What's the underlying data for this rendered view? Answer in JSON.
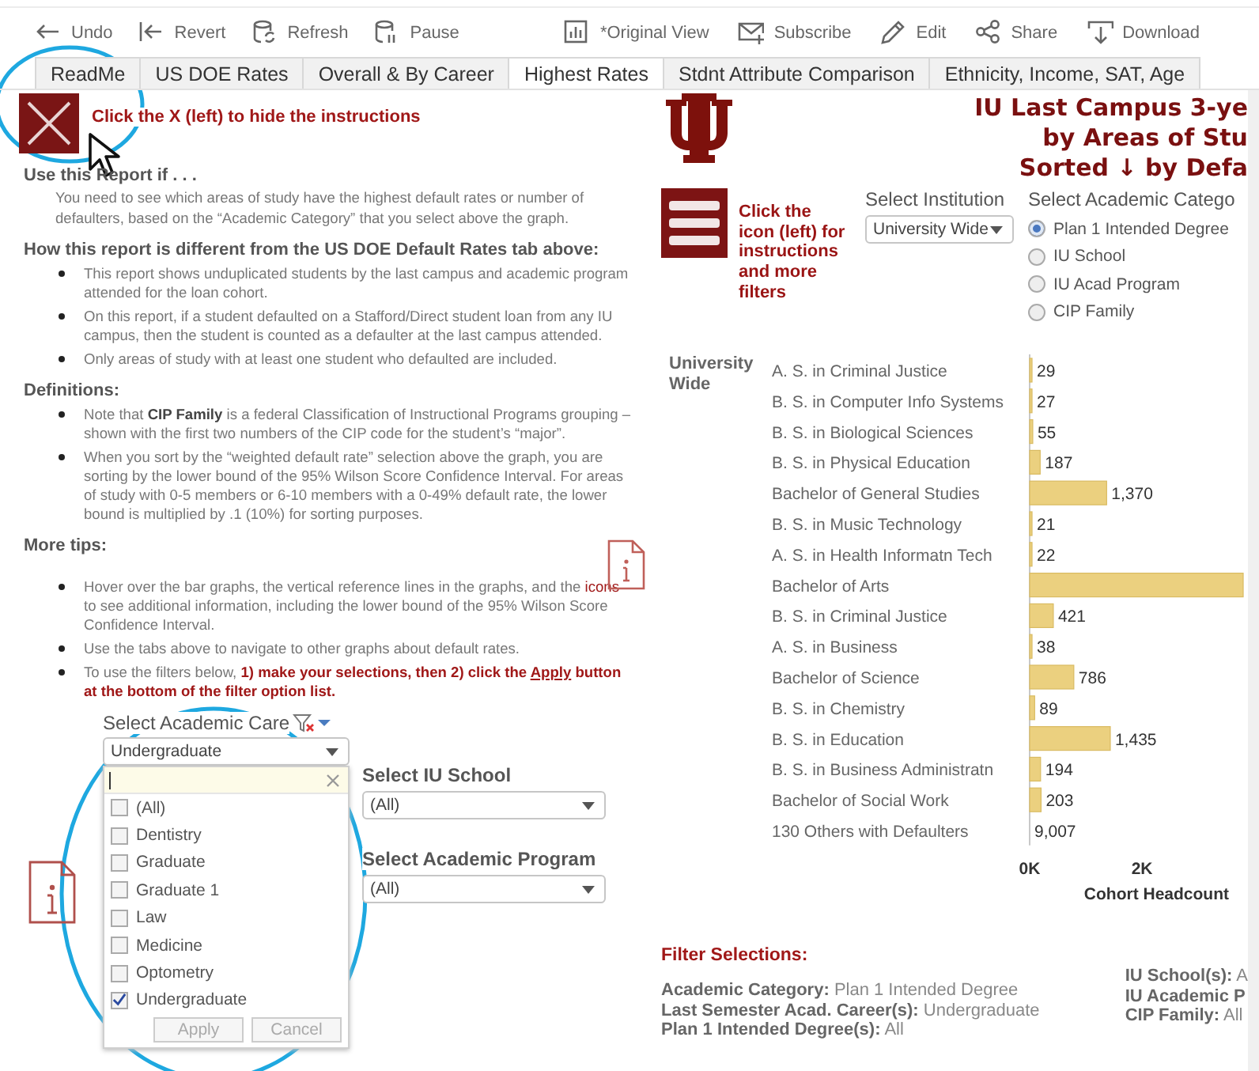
{
  "toolbar": {
    "left": [
      {
        "label": "Undo"
      },
      {
        "label": "Revert"
      },
      {
        "label": "Refresh"
      },
      {
        "label": "Pause"
      }
    ],
    "right": [
      {
        "label": "*Original View"
      },
      {
        "label": "Subscribe"
      },
      {
        "label": "Edit"
      },
      {
        "label": "Share"
      },
      {
        "label": "Download"
      }
    ]
  },
  "tabs": [
    {
      "label": "ReadMe",
      "selected": false
    },
    {
      "label": "US DOE Rates",
      "selected": false
    },
    {
      "label": "Overall & By Career",
      "selected": false
    },
    {
      "label": "Highest Rates",
      "selected": true
    },
    {
      "label": "Stdnt Attribute Comparison",
      "selected": false
    },
    {
      "label": "Ethnicity, Income, SAT, Age",
      "selected": false
    }
  ],
  "instructions": {
    "hide_text": "Click the X (left) to hide the instructions",
    "sections": [
      {
        "heading": "Use this Report if . . .",
        "kind": "paragraph",
        "items": [
          [
            {
              "text": "You need to see which areas of study have the highest default rates or number of defaulters, based on the “Academic Category” that you select above the graph.",
              "kind": "text"
            }
          ]
        ]
      },
      {
        "heading": "How this report is different from the US DOE Default Rates tab above:",
        "kind": "bullets",
        "items": [
          [
            {
              "text": "This report shows unduplicated students by the last campus and academic program attended for the loan cohort.",
              "kind": "text"
            }
          ],
          [
            {
              "text": "On this report, if a student defaulted on a Stafford/Direct student loan from any IU campus, then the student is counted as a defaulter at the last campus attended.",
              "kind": "text"
            }
          ],
          [
            {
              "text": "Only areas of study with at least one student who defaulted are included.",
              "kind": "text"
            }
          ]
        ]
      },
      {
        "heading": "Definitions:",
        "kind": "bullets",
        "items": [
          [
            {
              "text": "Note that ",
              "kind": "text"
            },
            {
              "text": "CIP Family",
              "kind": "term"
            },
            {
              "text": " is a federal Classification of Instructional Programs grouping – shown with the first two numbers of the CIP code for the student’s “major”.",
              "kind": "text"
            }
          ],
          [
            {
              "text": "When you sort by the “weighted default rate” selection above the graph, you are sorting by the lower bound of the 95% Wilson Score Confidence Interval.  For areas of study with 0-5 members or 6-10 members with a 0-49% default rate, the lower bound is multiplied by .1 (10%) for sorting purposes.",
              "kind": "text"
            }
          ]
        ]
      },
      {
        "heading": "More tips:",
        "kind": "tips",
        "items": [
          [
            {
              "text": "Hover over the bar graphs, the vertical reference lines in the graphs, and the ",
              "kind": "text"
            },
            {
              "text": "icons",
              "kind": "highlight"
            },
            {
              "text": " to see additional information, including the lower bound of the 95% Wilson Score Confidence Interval.",
              "kind": "text"
            }
          ],
          [
            {
              "text": "Use the tabs above to navigate to other graphs about default rates.",
              "kind": "text"
            }
          ],
          [
            {
              "text": "To use the filters below, ",
              "kind": "text"
            },
            {
              "text": "1) make your selections, then 2) click the ",
              "kind": "instruction"
            },
            {
              "text": "Apply",
              "kind": "link"
            },
            {
              "text": " button at the bottom of the filter option list.",
              "kind": "instruction"
            }
          ]
        ]
      }
    ]
  },
  "career_filter": {
    "label": "Select Academic Care",
    "value": "Undergraduate",
    "options": [
      {
        "label": "(All)",
        "checked": false
      },
      {
        "label": "Dentistry",
        "checked": false
      },
      {
        "label": "Graduate",
        "checked": false
      },
      {
        "label": "Graduate 1",
        "checked": false
      },
      {
        "label": "Law",
        "checked": false
      },
      {
        "label": "Medicine",
        "checked": false
      },
      {
        "label": "Optometry",
        "checked": false
      },
      {
        "label": "Undergraduate",
        "checked": true
      }
    ],
    "buttons": [
      {
        "label": "Apply",
        "disabled": true
      },
      {
        "label": "Cancel",
        "disabled": true
      }
    ]
  },
  "school_filter": {
    "label": "Select IU School",
    "value": "(All)"
  },
  "program_filter": {
    "label": "Select Academic Program",
    "value": "(All)"
  },
  "title_lines": [
    "IU Last Campus 3-ye",
    "by Areas of Stu",
    "Sorted ↓ by Defa"
  ],
  "menu_hint": "Click the icon (left) for instructions and more filters",
  "institution": {
    "label": "Select Institution",
    "value": "University Wide"
  },
  "category": {
    "label": "Select Academic Catego",
    "options": [
      {
        "label": "Plan 1 Intended Degree",
        "selected": true
      },
      {
        "label": "IU School",
        "selected": false
      },
      {
        "label": "IU Acad Program",
        "selected": false
      },
      {
        "label": "CIP Family",
        "selected": false
      }
    ]
  },
  "chart_group": "University Wide",
  "chart_data": {
    "type": "bar",
    "orientation": "horizontal",
    "xlabel": "Cohort Headcount",
    "categories": [
      "A. S. in Criminal Justice",
      "B. S. in Computer Info Systems",
      "B. S. in Biological Sciences",
      "B. S. in Physical Education",
      "Bachelor of General Studies",
      "B. S. in Music Technology",
      "A. S. in Health Informatn Tech",
      "Bachelor of Arts",
      "B. S. in Criminal Justice",
      "A. S. in Business",
      "Bachelor of Science",
      "B. S. in Chemistry",
      "B. S. in Education",
      "B. S. in Business Administratn",
      "Bachelor of Social Work",
      "130 Others with Defaulters"
    ],
    "values": [
      29,
      27,
      55,
      187,
      1370,
      21,
      22,
      3800,
      421,
      38,
      786,
      89,
      1435,
      194,
      203,
      null
    ],
    "value_labels": [
      "29",
      "27",
      "55",
      "187",
      "1,370",
      "21",
      "22",
      null,
      "421",
      "38",
      "786",
      "89",
      "1,435",
      "194",
      "203",
      "9,007"
    ],
    "xlim": [
      0,
      3800
    ],
    "xticks": [
      {
        "value": 0,
        "label": "0K"
      },
      {
        "value": 2000,
        "label": "2K"
      }
    ]
  },
  "filter_selections": {
    "title": "Filter Selections:",
    "left": [
      {
        "label": "Academic Category:",
        "value": "Plan 1 Intended Degree"
      },
      {
        "label": "Last Semester Acad. Career(s):",
        "value": "Undergraduate"
      },
      {
        "label": "Plan 1 Intended Degree(s):",
        "value": "All"
      }
    ],
    "right": [
      {
        "label": "IU School(s):",
        "value": "A"
      },
      {
        "label": "IU Academic P"
      },
      {
        "label": "CIP Family:",
        "value": "All"
      }
    ]
  }
}
